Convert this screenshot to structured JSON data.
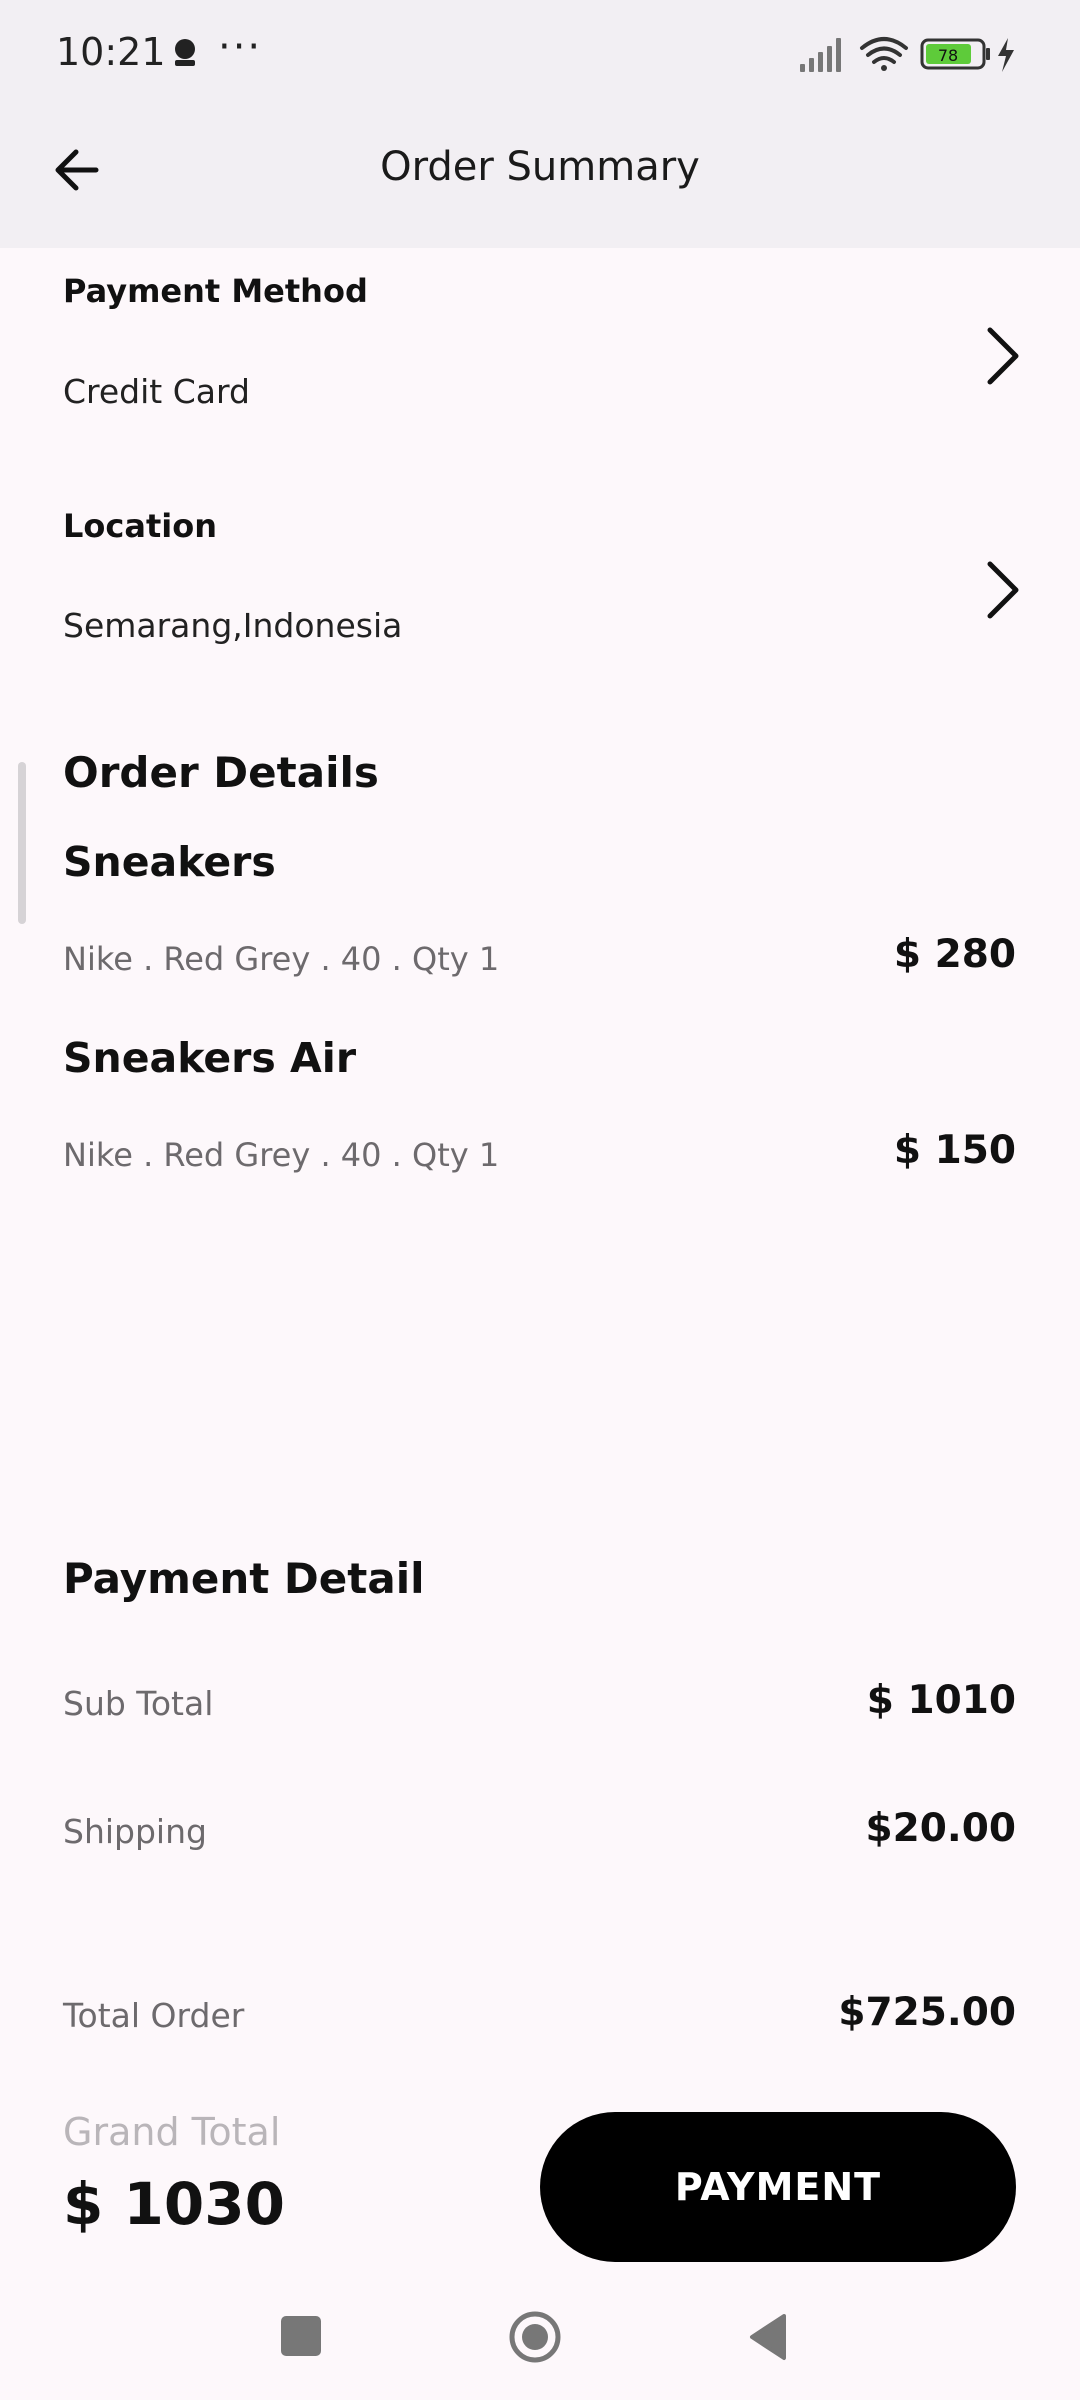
{
  "status_bar": {
    "time": "10:21",
    "dots": "···",
    "battery": "78"
  },
  "app_bar": {
    "title": "Order Summary"
  },
  "payment_method": {
    "label": "Payment Method",
    "value": "Credit Card"
  },
  "location": {
    "label": "Location",
    "value": "Semarang,Indonesia"
  },
  "order_details": {
    "title": "Order Details",
    "items": [
      {
        "name": "Sneakers",
        "meta": "Nike . Red Grey . 40 . Qty 1",
        "price": "$ 280"
      },
      {
        "name": "Sneakers Air",
        "meta": "Nike . Red Grey . 40 . Qty 1",
        "price": "$ 150"
      }
    ]
  },
  "payment_detail": {
    "title": "Payment Detail",
    "sub_total_label": "Sub Total",
    "sub_total_value": "$ 1010",
    "shipping_label": "Shipping",
    "shipping_value": "$20.00",
    "total_order_label": "Total Order",
    "total_order_value": "$725.00"
  },
  "footer": {
    "grand_total_label": "Grand Total",
    "grand_total_value": "$ 1030",
    "payment_button": "PAYMENT"
  },
  "colors": {
    "background": "#fdf8fb",
    "app_bar": "#f2eff3",
    "button": "#000000",
    "battery_fill": "#5ecb3a"
  }
}
